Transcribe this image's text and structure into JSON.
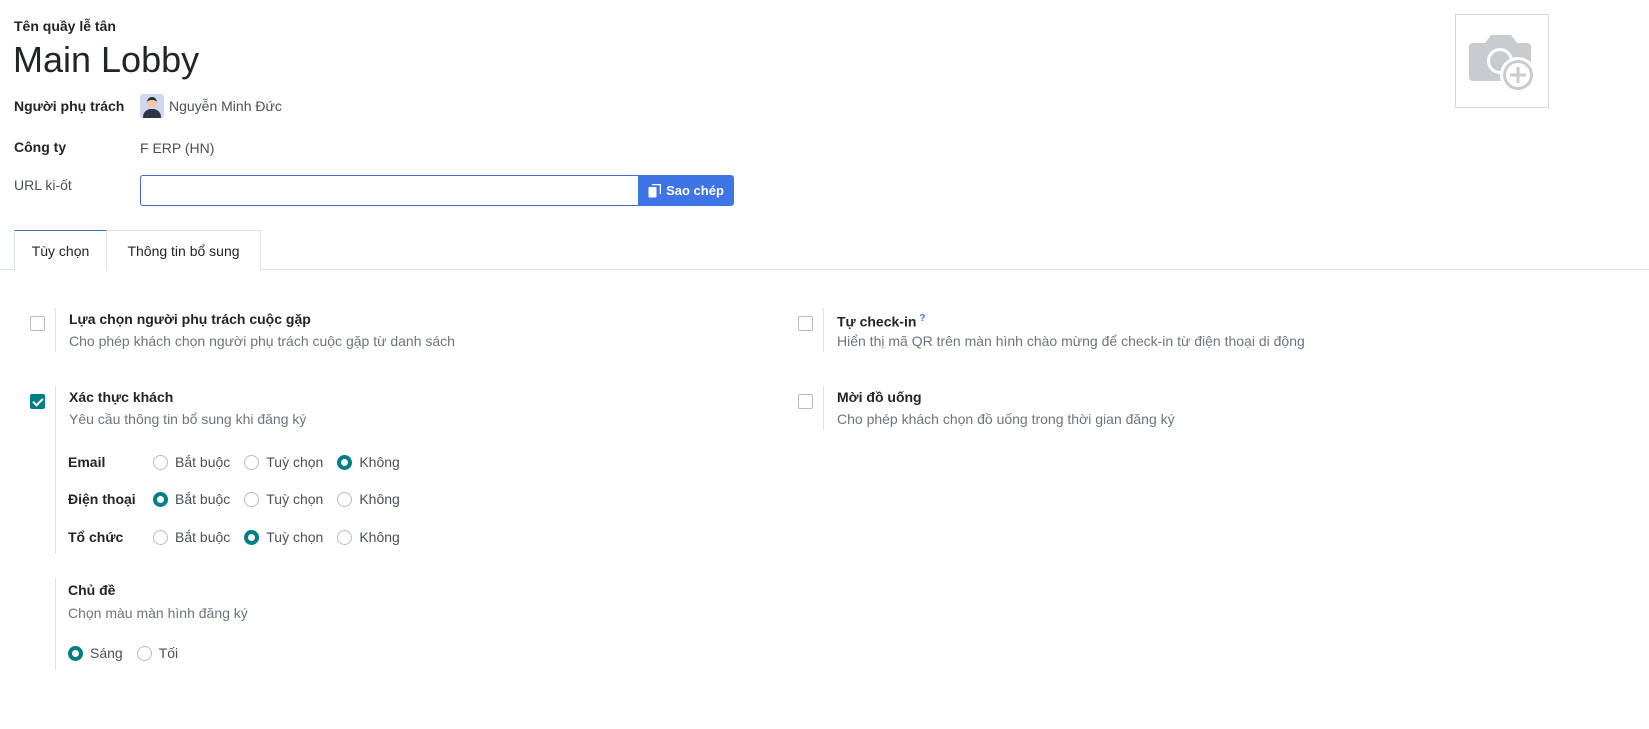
{
  "header": {
    "caption": "Tên quầy lễ tân",
    "title": "Main Lobby",
    "image_icon": "camera-add-icon"
  },
  "fields": {
    "responsible_label": "Người phụ trách",
    "responsible_name": "Nguyễn Minh Đức",
    "company_label": "Công ty",
    "company_value": "F ERP (HN)",
    "kiosk_url_label": "URL ki-ốt",
    "kiosk_url_value": "",
    "copy_button": "Sao chép"
  },
  "tabs": [
    {
      "label": "Tùy chọn",
      "active": true
    },
    {
      "label": "Thông tin bổ sung",
      "active": false
    }
  ],
  "settings": {
    "host_selection": {
      "title": "Lựa chọn người phụ trách cuộc gặp",
      "desc": "Cho phép khách chọn người phụ trách cuộc gặp từ danh sách",
      "checked": false
    },
    "self_checkin": {
      "title": "Tự check-in",
      "help": "?",
      "desc": "Hiển thị mã QR trên màn hình chào mừng để check-in từ điện thoại di động",
      "checked": false
    },
    "guest_verification": {
      "title": "Xác thực khách",
      "desc": "Yêu cầu thông tin bổ sung khi đăng ký",
      "checked": true
    },
    "offer_drinks": {
      "title": "Mời đồ uống",
      "desc": "Cho phép khách chọn đồ uống trong thời gian đăng ký",
      "checked": false
    }
  },
  "requirements": {
    "options": [
      "Bắt buộc",
      "Tuỳ chọn",
      "Không"
    ],
    "rows": [
      {
        "label": "Email",
        "selected": "Không"
      },
      {
        "label": "Điện thoại",
        "selected": "Bắt buộc"
      },
      {
        "label": "Tổ chức",
        "selected": "Tuỳ chọn"
      }
    ]
  },
  "theme": {
    "title": "Chủ đề",
    "desc": "Chọn màu màn hình đăng ký",
    "options": [
      "Sáng",
      "Tối"
    ],
    "selected": "Sáng"
  },
  "colors": {
    "accent": "#017e84",
    "primary_button": "#3e74e6"
  }
}
